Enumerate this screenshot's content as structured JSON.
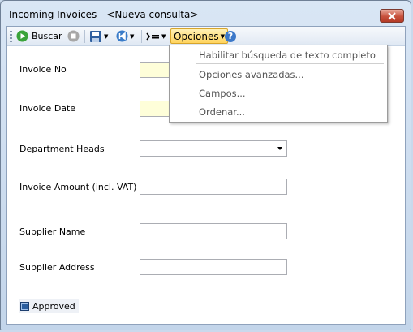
{
  "window": {
    "title": "Incoming Invoices - <Nueva consulta>"
  },
  "toolbar": {
    "search_label": "Buscar",
    "options_label": "Opciones",
    "help_glyph": "?"
  },
  "form": {
    "invoice_no": {
      "label": "Invoice No",
      "value": ""
    },
    "invoice_date": {
      "label": "Invoice Date",
      "value": ""
    },
    "department_heads": {
      "label": "Department Heads",
      "value": ""
    },
    "invoice_amount": {
      "label": "Invoice Amount (incl. VAT)",
      "value": ""
    },
    "supplier_name": {
      "label": "Supplier Name",
      "value": ""
    },
    "supplier_address": {
      "label": "Supplier Address",
      "value": ""
    },
    "approved": {
      "label": "Approved"
    }
  },
  "options_menu": {
    "items": [
      "Habilitar búsqueda de texto completo",
      "Opciones avanzadas...",
      "Campos...",
      "Ordenar..."
    ]
  },
  "colors": {
    "accent": "#ffd45e",
    "required_field": "#fefed9",
    "close_button": "#c8523d"
  }
}
